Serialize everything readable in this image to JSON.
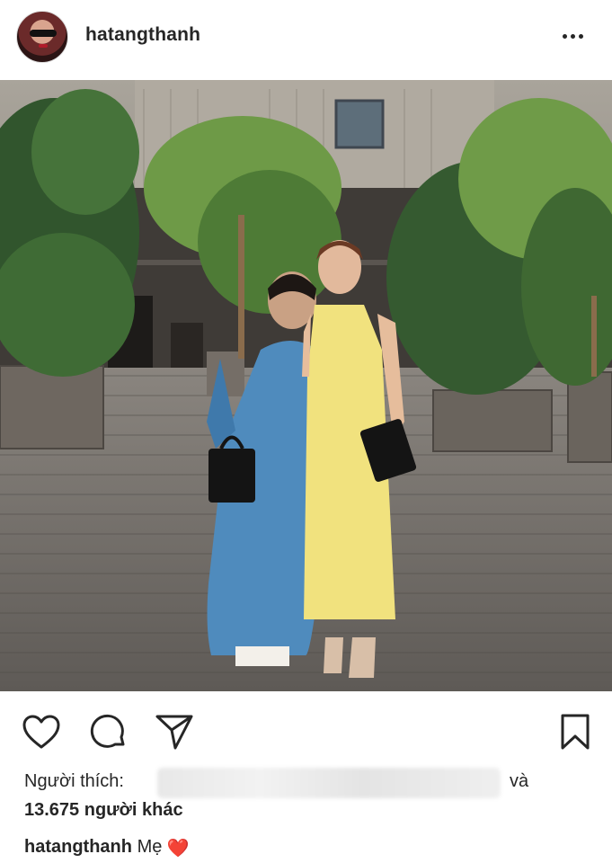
{
  "post": {
    "username": "hatangthanh",
    "more_icon": "more-horizontal-icon",
    "image_alt_colors": {
      "sky": "#d7dcd9",
      "wood": "#7c7670",
      "dress_yellow": "#f1e27e",
      "ao_dai_blue": "#4f8bbd"
    }
  },
  "actions": {
    "like_icon": "heart-outline-icon",
    "comment_icon": "comment-icon",
    "share_icon": "send-icon",
    "save_icon": "bookmark-icon"
  },
  "likes": {
    "label": "Người thích:",
    "and": "và",
    "count_text": "13.675 người khác"
  },
  "caption": {
    "username": "hatangthanh",
    "text": "Mẹ",
    "emoji": "❤️"
  }
}
